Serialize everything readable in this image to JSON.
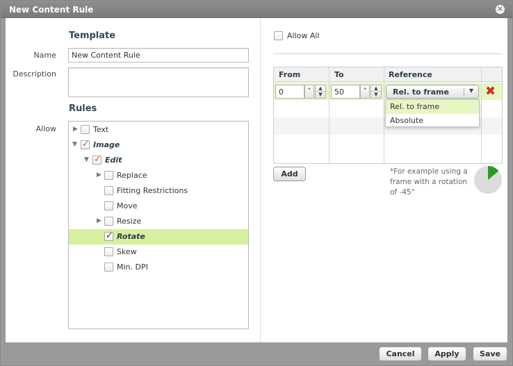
{
  "dialog": {
    "title": "New Content Rule"
  },
  "template": {
    "section_title": "Template",
    "name_label": "Name",
    "name_value": "New Content Rule",
    "description_label": "Description",
    "description_value": ""
  },
  "rules": {
    "section_title": "Rules",
    "allow_label": "Allow",
    "tree": [
      {
        "label": "Text",
        "checked": false,
        "expandable": true,
        "expanded": false,
        "level": 0
      },
      {
        "label": "Image",
        "checked": true,
        "expandable": true,
        "expanded": true,
        "level": 0
      },
      {
        "label": "Edit",
        "checked": true,
        "expandable": true,
        "expanded": true,
        "level": 1
      },
      {
        "label": "Replace",
        "checked": false,
        "expandable": true,
        "expanded": false,
        "level": 2
      },
      {
        "label": "Fitting Restrictions",
        "checked": false,
        "expandable": false,
        "level": 2
      },
      {
        "label": "Move",
        "checked": false,
        "expandable": false,
        "level": 2
      },
      {
        "label": "Resize",
        "checked": false,
        "expandable": true,
        "expanded": false,
        "level": 2
      },
      {
        "label": "Rotate",
        "checked": true,
        "expandable": false,
        "level": 2,
        "selected": true
      },
      {
        "label": "Skew",
        "checked": false,
        "expandable": false,
        "level": 2
      },
      {
        "label": "Min. DPI",
        "checked": false,
        "expandable": false,
        "level": 2
      }
    ]
  },
  "rotate_panel": {
    "allow_all_label": "Allow All",
    "allow_all_checked": false,
    "columns": [
      "From",
      "To",
      "Reference"
    ],
    "row": {
      "from_value": "0",
      "to_value": "50",
      "unit": "°",
      "reference_value": "Rel. to frame"
    },
    "reference_options": [
      "Rel. to frame",
      "Absolute"
    ],
    "add_label": "Add",
    "hint": "*For example using a frame with a rotation of -45°",
    "preview_angle_deg": 50
  },
  "footer": {
    "cancel_label": "Cancel",
    "apply_label": "Apply",
    "save_label": "Save"
  },
  "colors": {
    "accent_green": "#d6f0a0",
    "title_text": "#2f4a57",
    "delete_red": "#d62b1f",
    "preview_green": "#2a9a1f"
  },
  "icons": [
    "close-icon",
    "expand-arrow-icon",
    "collapse-arrow-icon",
    "spin-up-icon",
    "spin-down-icon",
    "caret-down-icon",
    "delete-icon",
    "rotation-preview-icon"
  ]
}
